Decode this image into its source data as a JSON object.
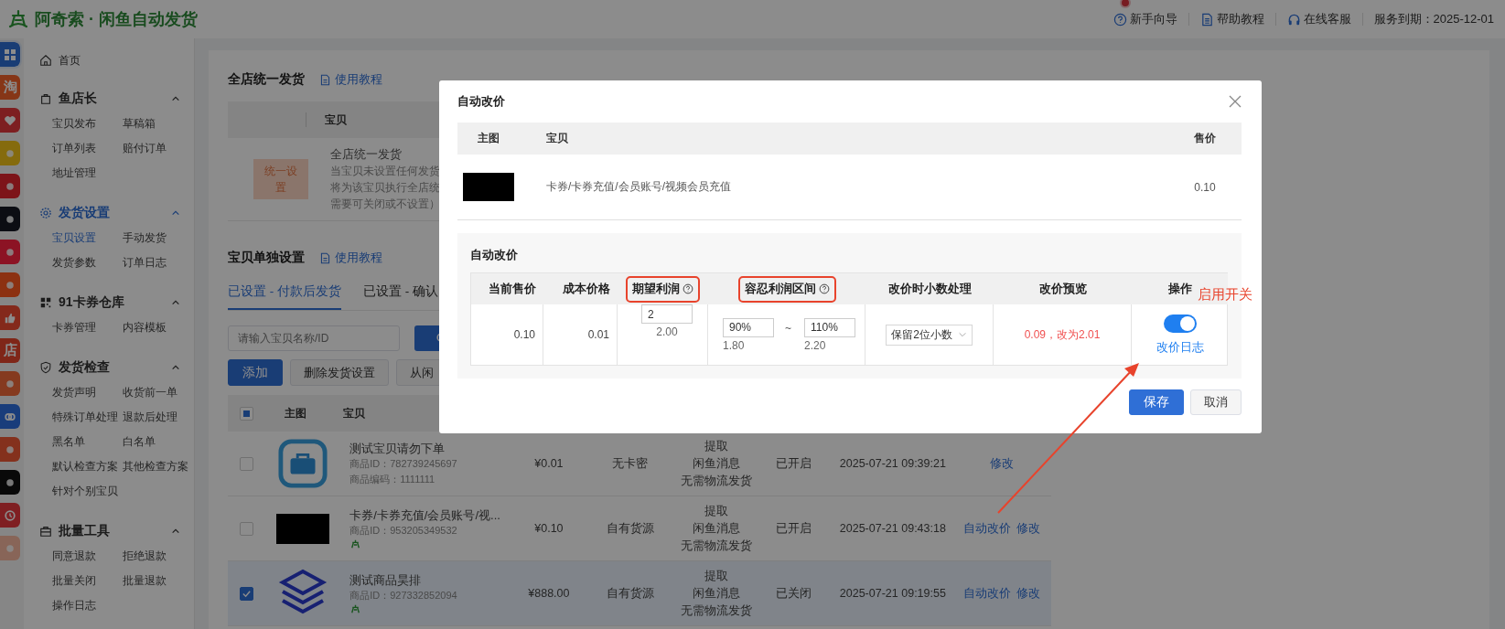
{
  "app": {
    "title": "阿奇索 · 闲鱼自动发货"
  },
  "top_links": [
    {
      "kind": "guide",
      "label": "新手向导",
      "badge": true
    },
    {
      "kind": "help",
      "label": "帮助教程",
      "badge": false
    },
    {
      "kind": "service",
      "label": "在线客服",
      "badge": false
    }
  ],
  "service_expiry": "服务到期：2025-12-01",
  "platform_icons": [
    {
      "kind": "grid",
      "selected": true
    },
    {
      "kind": "tao",
      "label": "淘",
      "selected": false
    },
    {
      "kind": "heart",
      "selected": false
    },
    {
      "kind": "fish",
      "selected": false
    },
    {
      "kind": "dog",
      "selected": false
    },
    {
      "kind": "note",
      "selected": false
    },
    {
      "kind": "book",
      "selected": false
    },
    {
      "kind": "rings",
      "selected": false
    },
    {
      "kind": "thumb",
      "selected": false
    },
    {
      "kind": "shop",
      "label": "店",
      "selected": false
    },
    {
      "kind": "bag",
      "selected": false
    },
    {
      "kind": "link",
      "selected": false
    },
    {
      "kind": "face",
      "selected": false
    },
    {
      "kind": "dark",
      "selected": false
    },
    {
      "kind": "clock",
      "selected": false
    },
    {
      "kind": "palebag",
      "selected": false
    }
  ],
  "sidebar": {
    "home": "首页",
    "groups": [
      {
        "kind": "bag",
        "title": "鱼店长",
        "expanded": true,
        "selected": false,
        "items": [
          {
            "label": "宝贝发布",
            "selected": false
          },
          {
            "label": "草稿箱",
            "selected": false
          },
          {
            "label": "订单列表",
            "selected": false
          },
          {
            "label": "赔付订单",
            "selected": false
          },
          {
            "label": "地址管理",
            "selected": false
          }
        ]
      },
      {
        "kind": "gear",
        "title": "发货设置",
        "expanded": true,
        "selected": true,
        "items": [
          {
            "label": "宝贝设置",
            "selected": true
          },
          {
            "label": "手动发货",
            "selected": false
          },
          {
            "label": "发货参数",
            "selected": false
          },
          {
            "label": "订单日志",
            "selected": false
          }
        ]
      },
      {
        "kind": "grid",
        "title": "91卡券仓库",
        "expanded": true,
        "selected": false,
        "items": [
          {
            "label": "卡券管理",
            "selected": false
          },
          {
            "label": "内容模板",
            "selected": false
          }
        ]
      },
      {
        "kind": "shield",
        "title": "发货检查",
        "expanded": true,
        "selected": false,
        "items": [
          {
            "label": "发货声明",
            "selected": false
          },
          {
            "label": "收货前一单",
            "selected": false
          },
          {
            "label": "特殊订单处理",
            "selected": false
          },
          {
            "label": "退款后处理",
            "selected": false
          },
          {
            "label": "黑名单",
            "selected": false
          },
          {
            "label": "白名单",
            "selected": false
          },
          {
            "label": "默认检查方案",
            "selected": false
          },
          {
            "label": "其他检查方案",
            "selected": false
          },
          {
            "label": "针对个别宝贝",
            "selected": false
          }
        ]
      },
      {
        "kind": "toolbox",
        "title": "批量工具",
        "expanded": true,
        "selected": false,
        "items": [
          {
            "label": "同意退款",
            "selected": false
          },
          {
            "label": "拒绝退款",
            "selected": false
          },
          {
            "label": "批量关闭",
            "selected": false
          },
          {
            "label": "批量退款",
            "selected": false
          },
          {
            "label": "操作日志",
            "selected": false
          }
        ]
      }
    ]
  },
  "store_delivery": {
    "title": "全店统一发货",
    "tutorial": "使用教程",
    "header": "宝贝",
    "badge": "统一设置",
    "lines": [
      "全店统一发货",
      "当宝贝未设置任何发货",
      "将为该宝贝执行全店统",
      "需要可关闭或不设置）"
    ]
  },
  "item_settings": {
    "title": "宝贝单独设置",
    "tutorial": "使用教程",
    "tabs": [
      {
        "label": "已设置 - 付款后发货",
        "selected": true
      },
      {
        "label": "已设置 - 确认",
        "selected": false
      }
    ],
    "search": {
      "placeholder": "请输入宝贝名称/ID"
    },
    "buttons": [
      {
        "label": "添加",
        "kind": "primary"
      },
      {
        "label": "删除发货设置",
        "kind": "default"
      },
      {
        "label": "从闲",
        "kind": "default"
      }
    ],
    "table": {
      "header_indeterminate": true,
      "columns": [
        "主图",
        "宝贝"
      ],
      "rows": [
        {
          "checked": false,
          "kind": "briefcase",
          "name": "测试宝贝请勿下单",
          "meta": [
            "商品ID：782739245697",
            "商品编码：1111111"
          ],
          "shop_mark": false,
          "price": "¥0.01",
          "source": "无卡密",
          "delivery": [
            "提取",
            "闲鱼消息",
            "无需物流发货"
          ],
          "status": "已开启",
          "time": "2025-07-21 09:39:21",
          "actions": [
            "修改"
          ]
        },
        {
          "checked": false,
          "kind": "redacted",
          "name": "卡券/卡券充值/会员账号/视...",
          "meta": [
            "商品ID：953205349532"
          ],
          "shop_mark": true,
          "price": "¥0.10",
          "source": "自有货源",
          "delivery": [
            "提取",
            "闲鱼消息",
            "无需物流发货"
          ],
          "status": "已开启",
          "time": "2025-07-21 09:43:18",
          "actions": [
            "自动改价",
            "修改"
          ]
        },
        {
          "checked": true,
          "kind": "layers",
          "name": "测试商品昊排",
          "meta": [
            "商品ID：927332852094"
          ],
          "shop_mark": true,
          "price": "¥888.00",
          "source": "自有货源",
          "delivery": [
            "提取",
            "闲鱼消息",
            "无需物流发货"
          ],
          "status": "已关闭",
          "time": "2025-07-21 09:19:55",
          "actions": [
            "自动改价",
            "修改"
          ]
        }
      ]
    }
  },
  "dialog": {
    "title": "自动改价",
    "product_table": {
      "columns": [
        "主图",
        "宝贝",
        "售价"
      ],
      "row": {
        "name": "卡券/卡券充值/会员账号/视频会员充值",
        "price": "0.10"
      }
    },
    "pricing": {
      "title": "自动改价",
      "columns": [
        {
          "label": "当前售价",
          "help": false,
          "highlighted": false
        },
        {
          "label": "成本价格",
          "help": false,
          "highlighted": false
        },
        {
          "label": "期望利润",
          "help": true,
          "highlighted": true
        },
        {
          "label": "容忍利润区间",
          "help": true,
          "highlighted": true
        },
        {
          "label": "改价时小数处理",
          "help": false,
          "highlighted": false
        },
        {
          "label": "改价预览",
          "help": false,
          "highlighted": false
        },
        {
          "label": "操作",
          "help": false,
          "highlighted": false
        }
      ],
      "row": {
        "current_price": "0.10",
        "cost": "0.01",
        "profit": "2",
        "profit_value": "2.00",
        "range_min": "90%",
        "range_sep": "~",
        "range_max": "110%",
        "range_min_value": "1.80",
        "range_max_value": "2.20",
        "decimal": "保留2位小数",
        "preview": "0.09，改为2.01",
        "enabled": true,
        "log": "改价日志"
      }
    },
    "buttons": [
      {
        "label": "保存",
        "kind": "primary"
      },
      {
        "label": "取消",
        "kind": "default"
      }
    ]
  },
  "annotation": {
    "label": "启用开关"
  }
}
